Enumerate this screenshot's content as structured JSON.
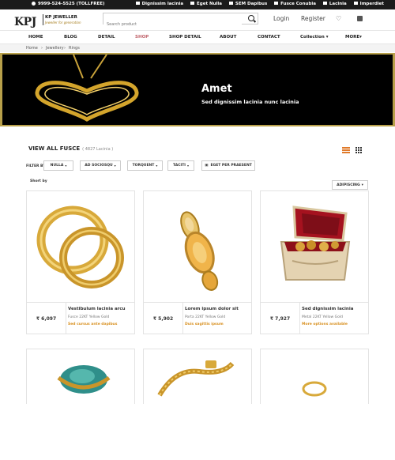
{
  "topbar": {
    "phone": "9999-524-5525",
    "phone_note": "(TOLLFREE)",
    "links": [
      "Dignissim lacinia",
      "Eget Nulla",
      "SEM Dapibus",
      "Fusce Conubia",
      "Lacinia",
      "Imperdiet"
    ]
  },
  "header": {
    "logo_mark": "KPJ",
    "logo_name": "KP JEWELLER",
    "logo_tagline": "Jeweller for generation",
    "search_placeholder": "Search product",
    "login": "Login",
    "register": "Register",
    "heart": "♡"
  },
  "nav": {
    "items": [
      "HOME",
      "BLOG",
      "DETAIL",
      "SHOP",
      "SHOP DETAIL",
      "ABOUT",
      "CONTACT",
      "Collection",
      "MORE"
    ],
    "active": "SHOP"
  },
  "breadcrumb": [
    "Home",
    "Jewellery",
    "Rings"
  ],
  "banner": {
    "title": "Amet",
    "subtitle": "Sed dignissim lacinia nunc lacinia"
  },
  "listing": {
    "heading": "VIEW ALL FUSCE",
    "count": "( 4827 Lacinia )",
    "filter_label": "FILTER BY",
    "filters": [
      "NULLA",
      "AD SOCIOSQU",
      "TORQUENT",
      "TACITI",
      "EGET PER PRAESENT"
    ],
    "sort_label": "Short by",
    "sort_value": "ADIPISCING"
  },
  "products": [
    {
      "price": "₹ 6,097",
      "name": "Vestibulum lacinia arcu",
      "metal": "Fusce 22KT Yellow Gold",
      "link": "Sed cursus ante dapibus"
    },
    {
      "price": "₹ 5,902",
      "name": "Lorem ipsum dolor sit",
      "metal": "Porta 22KT Yellow Gold",
      "link": "Duis sagittis ipsum"
    },
    {
      "price": "₹ 7,927",
      "name": "Sed dignissim lacinia",
      "metal": "Metal 22KT Yellow Gold",
      "link": "More options available"
    }
  ],
  "colors": {
    "accent": "#c0626a",
    "gold": "#b8a04a",
    "link": "#d89020",
    "topbar": "#1b1b1b"
  }
}
